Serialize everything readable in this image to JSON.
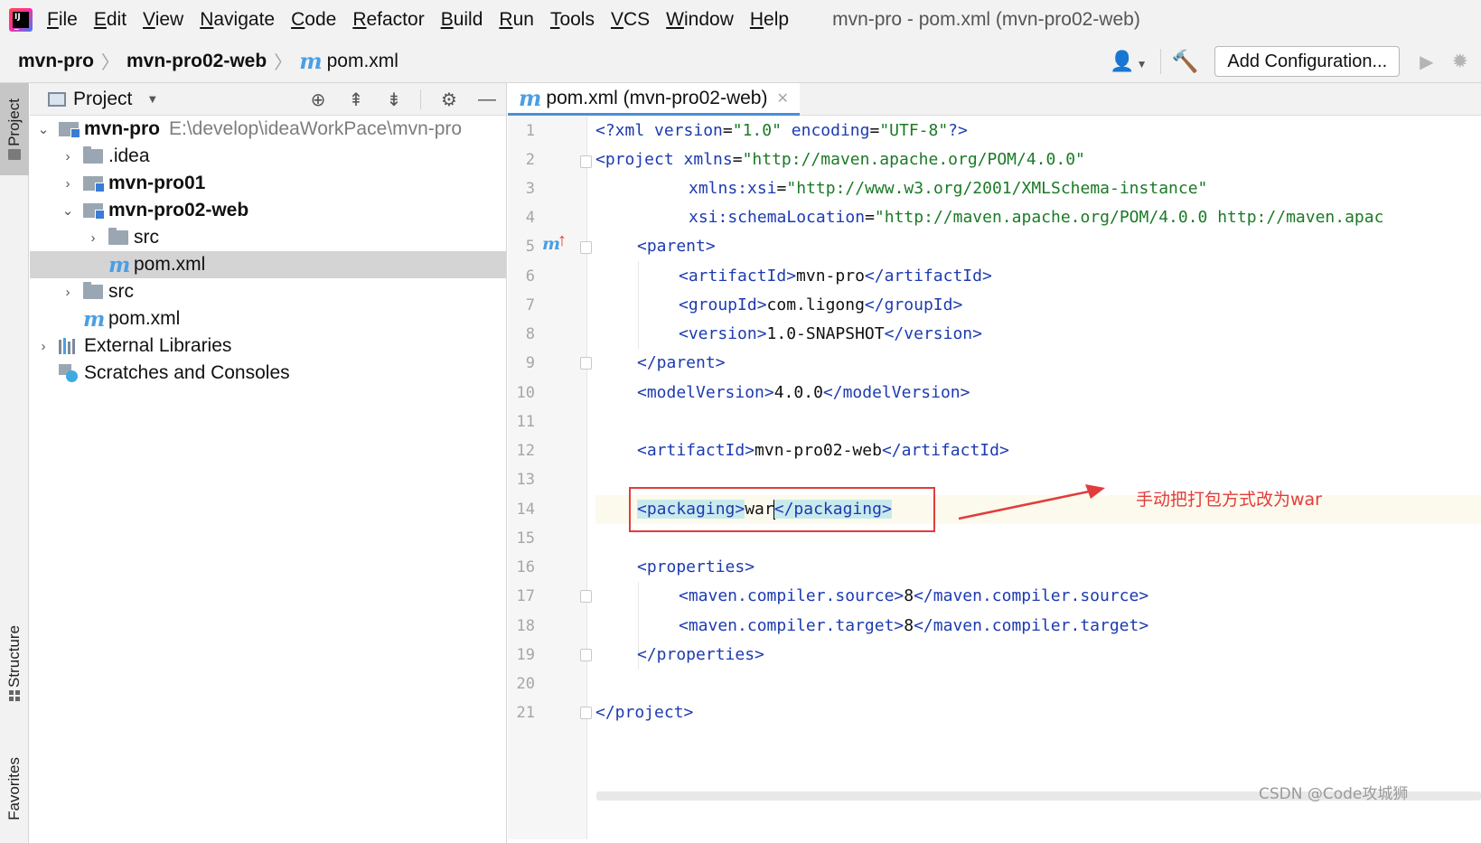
{
  "menubar": {
    "items": [
      {
        "first": "F",
        "rest": "ile"
      },
      {
        "first": "E",
        "rest": "dit"
      },
      {
        "first": "V",
        "rest": "iew"
      },
      {
        "first": "N",
        "rest": "avigate"
      },
      {
        "first": "C",
        "rest": "ode"
      },
      {
        "first": "R",
        "rest": "efactor"
      },
      {
        "first": "B",
        "rest": "uild"
      },
      {
        "first": "R",
        "rest": "un"
      },
      {
        "first": "T",
        "rest": "ools"
      },
      {
        "first": "V",
        "rest": "CS"
      },
      {
        "first": "W",
        "rest": "indow"
      },
      {
        "first": "H",
        "rest": "elp"
      }
    ],
    "window_title": "mvn-pro - pom.xml (mvn-pro02-web)"
  },
  "navbar": {
    "breadcrumbs": [
      "mvn-pro",
      "mvn-pro02-web",
      "pom.xml"
    ],
    "maven_glyph": "m",
    "add_configuration": "Add Configuration..."
  },
  "tool_strip": {
    "project": "Project",
    "structure": "Structure",
    "favorites": "Favorites"
  },
  "project_panel": {
    "title": "Project",
    "tree": [
      {
        "name": "mvn-pro",
        "path": "E:\\develop\\ideaWorkPace\\mvn-pro"
      },
      {
        "name": ".idea"
      },
      {
        "name": "mvn-pro01"
      },
      {
        "name": "mvn-pro02-web"
      },
      {
        "name": "src"
      },
      {
        "name": "pom.xml"
      },
      {
        "name": "src"
      },
      {
        "name": "pom.xml"
      },
      {
        "name": "External Libraries"
      },
      {
        "name": "Scratches and Consoles"
      }
    ]
  },
  "editor": {
    "tab_label": "pom.xml (mvn-pro02-web)",
    "line_numbers": [
      "1",
      "2",
      "3",
      "4",
      "5",
      "6",
      "7",
      "8",
      "9",
      "10",
      "11",
      "12",
      "13",
      "14",
      "15",
      "16",
      "17",
      "18",
      "19",
      "20",
      "21"
    ],
    "current_line": 14,
    "lines": {
      "l1": {
        "a": "<?xml ",
        "b": "version",
        "c": "=",
        "d": "\"1.0\"",
        "e": " ",
        "f": "encoding",
        "g": "=",
        "h": "\"UTF-8\"",
        "i": "?>"
      },
      "l2": {
        "a": "<project ",
        "b": "xmlns",
        "c": "=",
        "d": "\"http://maven.apache.org/POM/4.0.0\""
      },
      "l3": {
        "a": "xmlns:xsi",
        "b": "=",
        "c": "\"http://www.w3.org/2001/XMLSchema-instance\""
      },
      "l4": {
        "a": "xsi:schemaLocation",
        "b": "=",
        "c": "\"http://maven.apache.org/POM/4.0.0 http://maven.apac"
      },
      "l5": {
        "a": "<parent>"
      },
      "l6": {
        "a": "<artifactId>",
        "b": "mvn-pro",
        "c": "</artifactId>"
      },
      "l7": {
        "a": "<groupId>",
        "b": "com.ligong",
        "c": "</groupId>"
      },
      "l8": {
        "a": "<version>",
        "b": "1.0-SNAPSHOT",
        "c": "</version>"
      },
      "l9": {
        "a": "</parent>"
      },
      "l10": {
        "a": "<modelVersion>",
        "b": "4.0.0",
        "c": "</modelVersion>"
      },
      "l12": {
        "a": "<artifactId>",
        "b": "mvn-pro02-web",
        "c": "</artifactId>"
      },
      "l14": {
        "a": "<packaging>",
        "b": "war",
        "c": "</packaging>"
      },
      "l16": {
        "a": "<properties>"
      },
      "l17": {
        "a": "<maven.compiler.source>",
        "b": "8",
        "c": "</maven.compiler.source>"
      },
      "l18": {
        "a": "<maven.compiler.target>",
        "b": "8",
        "c": "</maven.compiler.target>"
      },
      "l19": {
        "a": "</properties>"
      },
      "l21": {
        "a": "</project>"
      }
    }
  },
  "annotation": {
    "text": "手动把打包方式改为war",
    "color": "#e23c3c"
  },
  "watermark": "CSDN @Code攻城狮",
  "colors": {
    "tag": "#1d3bb0",
    "value": "#1b7a26",
    "maven": "#4a9fe4",
    "accent": "#4a8fd8"
  }
}
